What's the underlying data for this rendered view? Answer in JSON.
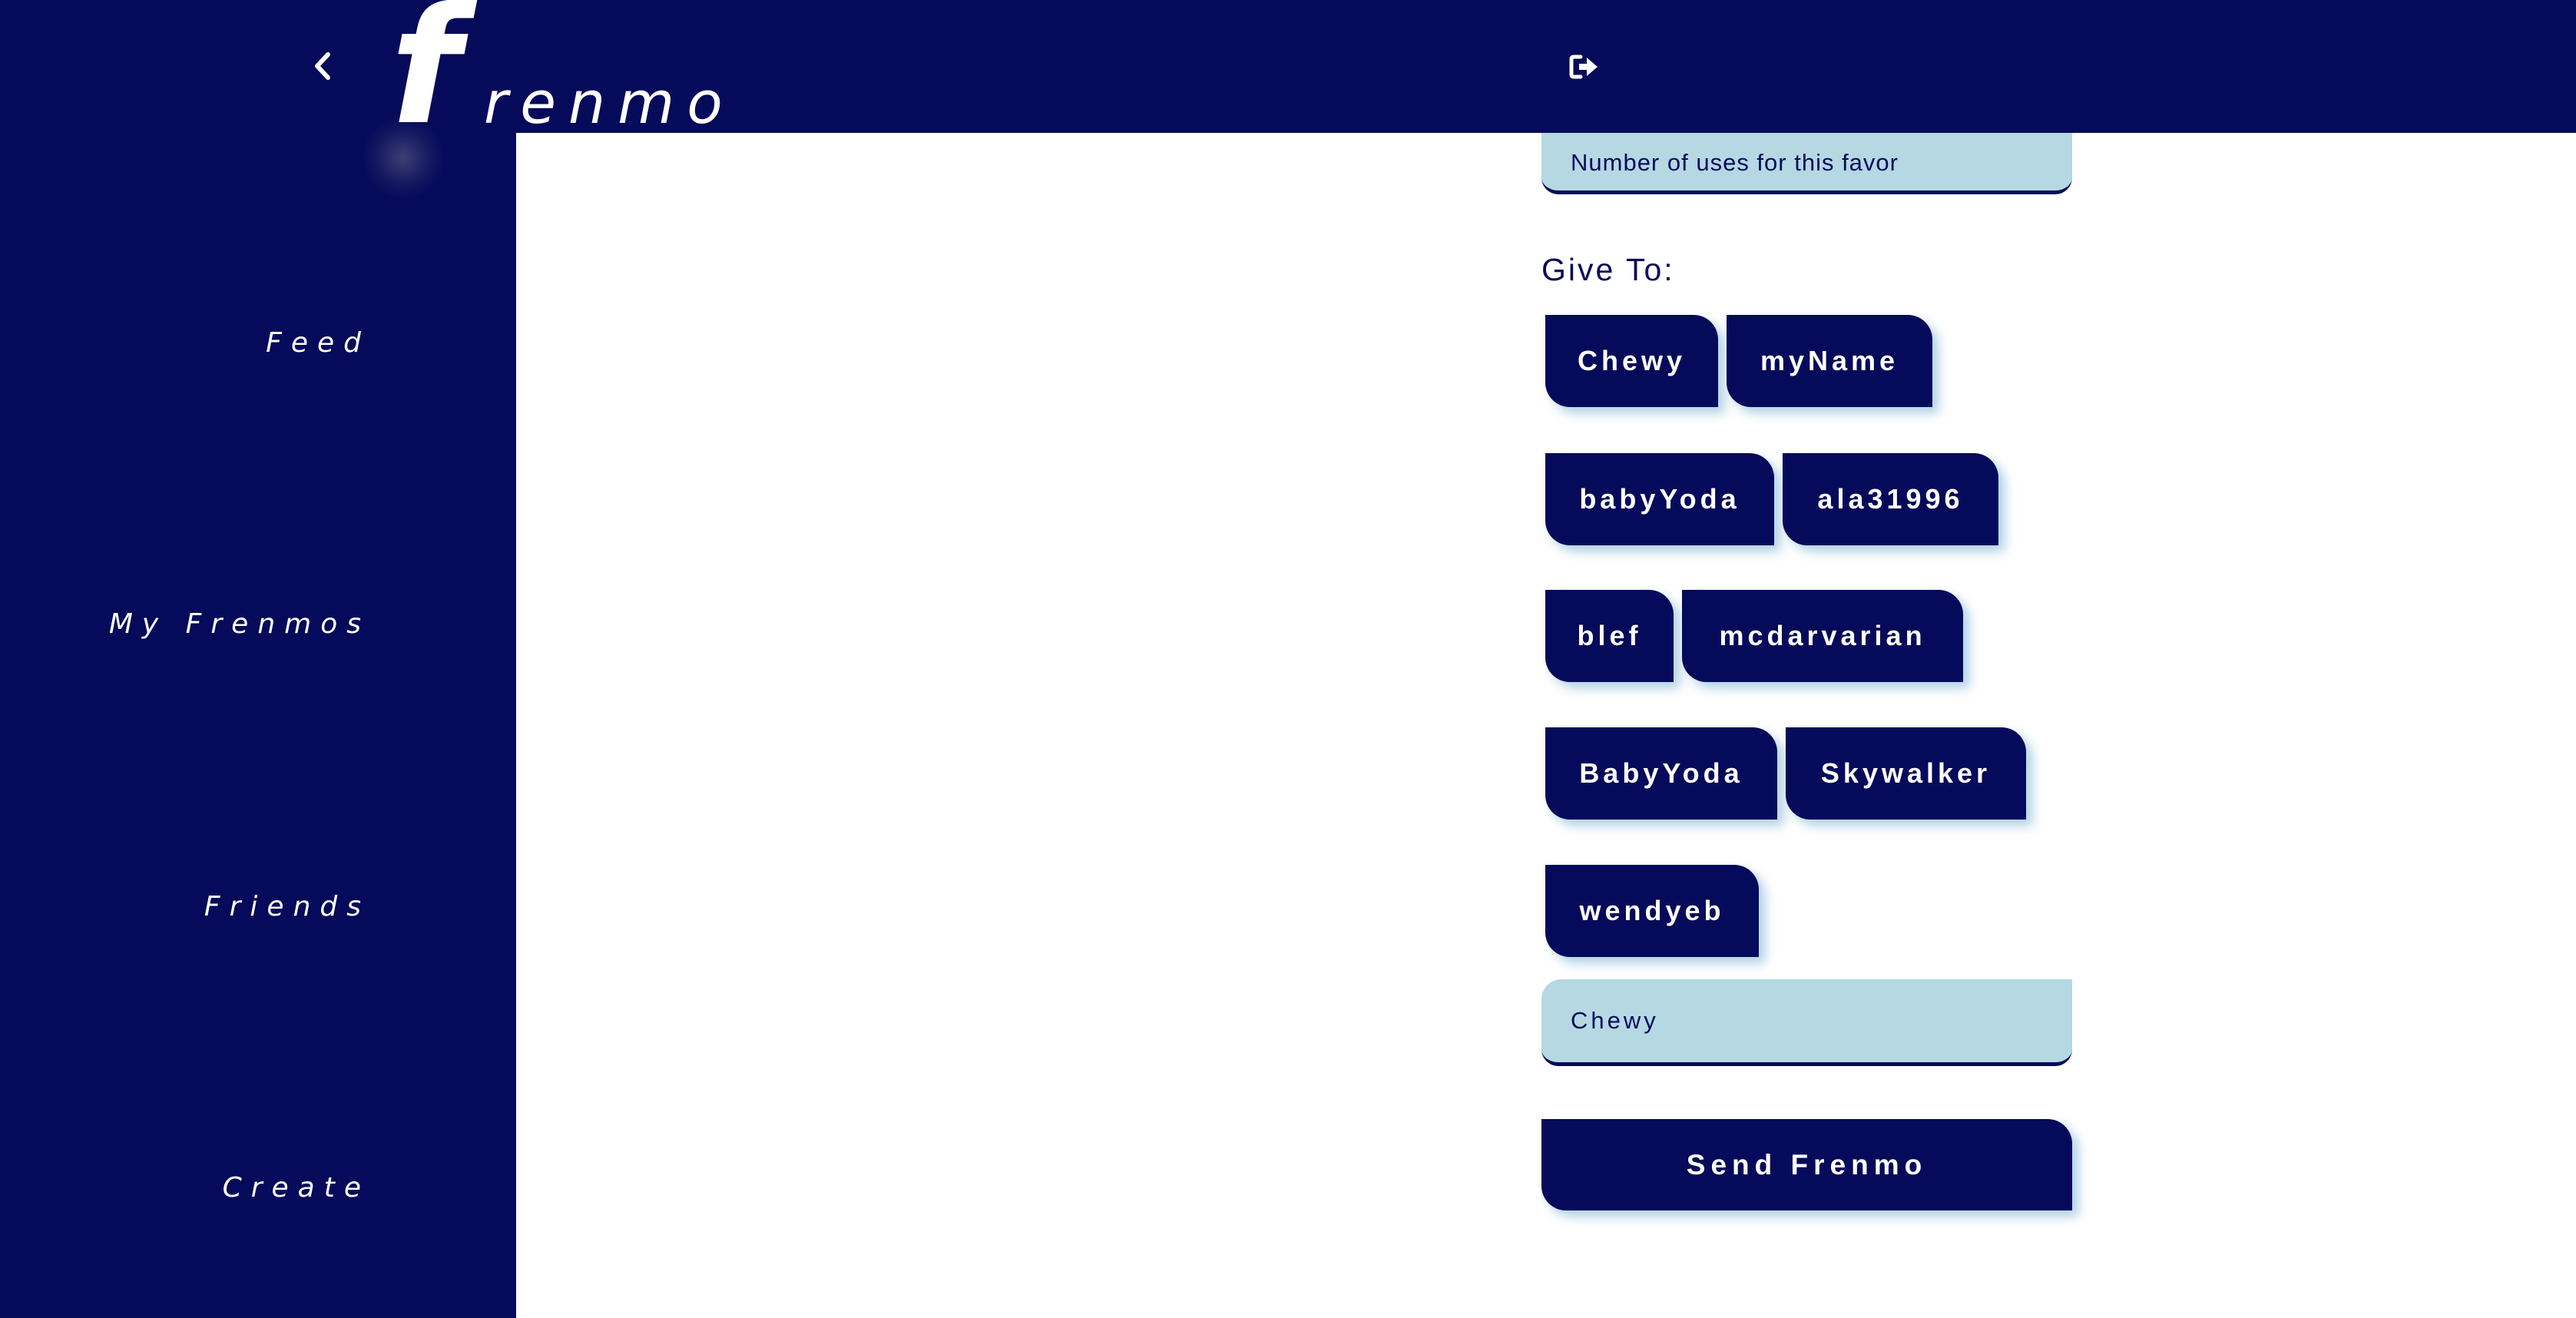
{
  "app": {
    "logo_first": "f",
    "logo_rest": "renmo"
  },
  "header": {
    "back_icon": "chevron-left-icon",
    "logout_icon": "sign-out-icon"
  },
  "nav": {
    "items": [
      {
        "label": "Feed"
      },
      {
        "label": "My Frenmos"
      },
      {
        "label": "Friends"
      },
      {
        "label": "Create"
      }
    ]
  },
  "form": {
    "uses_placeholder": "Number of uses for this favor",
    "give_to_label": "Give To:",
    "recipients": [
      "Chewy",
      "myName",
      "babyYoda",
      "ala31996",
      "blef",
      "mcdarvarian",
      "BabyYoda",
      "Skywalker",
      "wendyeb"
    ],
    "selected_recipient": "Chewy",
    "send_label": "Send Frenmo"
  },
  "colors": {
    "primary": "#060a5a",
    "input_bg": "#b5d8e3",
    "background": "#ffffff",
    "text_on_primary": "#ffffff"
  }
}
